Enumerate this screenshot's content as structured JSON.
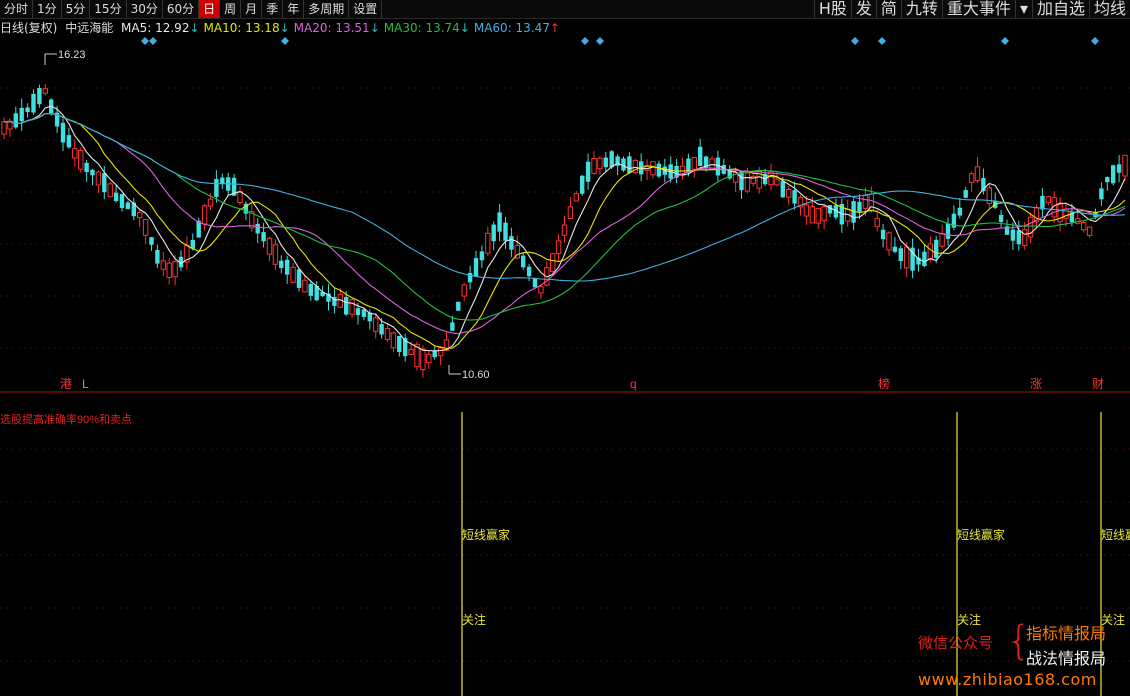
{
  "toolbar": {
    "left": [
      "分时",
      "1分",
      "5分",
      "15分",
      "30分",
      "60分",
      "日",
      "周",
      "月",
      "季",
      "年",
      "多周期",
      "设置"
    ],
    "active": "日",
    "right": [
      "H股",
      "发",
      "简",
      "九转",
      "重大事件",
      "▾",
      "加自选",
      "均线"
    ]
  },
  "legend": {
    "period": "日线(复权)",
    "name": "中远海能",
    "items": [
      {
        "label": "MA5: 12.92",
        "arrow": "↓",
        "color": "#e8e8e8"
      },
      {
        "label": "MA10: 13.18",
        "arrow": "↓",
        "color": "#e6e600"
      },
      {
        "label": "MA20: 13.51",
        "arrow": "↓",
        "color": "#e060e0"
      },
      {
        "label": "MA30: 13.74",
        "arrow": "↓",
        "color": "#20c040"
      },
      {
        "label": "MA60: 13.47",
        "arrow": "↑",
        "color": "#40b0e0"
      }
    ]
  },
  "chart_data": {
    "type": "candlestick",
    "series": [
      {
        "name": "MA5",
        "color": "#e8e8e8"
      },
      {
        "name": "MA10",
        "color": "#e6e600"
      },
      {
        "name": "MA20",
        "color": "#e060e0"
      },
      {
        "name": "MA30",
        "color": "#20c040"
      },
      {
        "name": "MA60",
        "color": "#40b0e0"
      }
    ],
    "annotations": {
      "high_label": "16.23",
      "low_label": "10.60"
    },
    "event_markers": [
      {
        "text": "港",
        "color": "#ff3030"
      },
      {
        "text": "L",
        "color": "#40b0ff"
      },
      {
        "text": "q",
        "color": "#ff3030"
      },
      {
        "text": "榜",
        "color": "#ff3030"
      },
      {
        "text": "涨",
        "color": "#ff3030"
      },
      {
        "text": "财",
        "color": "#ff3030"
      }
    ],
    "indicator": {
      "title": "选股提高准确率90%和卖点",
      "signals": [
        {
          "label": "短线赢家",
          "sub": "关注"
        },
        {
          "label": "短线赢家",
          "sub": "关注"
        },
        {
          "label": "短线赢",
          "sub": "关注"
        }
      ]
    }
  },
  "watermark": {
    "left": "微信公众号",
    "brace": "{",
    "right1": "指标情报局",
    "right2": "战法情报局",
    "url": "www.zhibiao168.com"
  }
}
